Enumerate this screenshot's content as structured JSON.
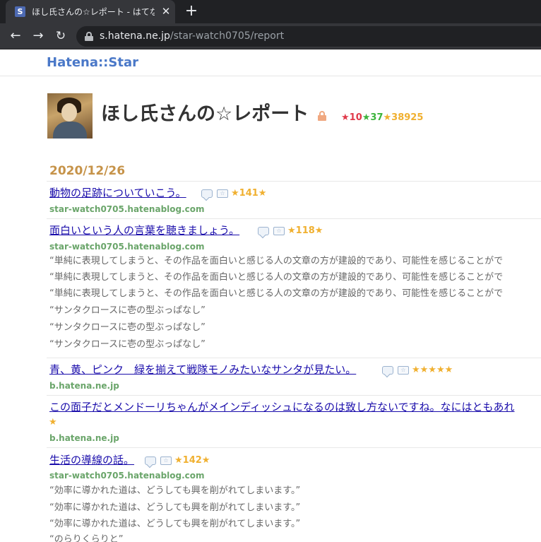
{
  "browser": {
    "tab_title": "ほし氏さんの☆レポート - はてなスター",
    "tab_favicon": "S",
    "close_glyph": "✕",
    "newtab_glyph": "+",
    "back_glyph": "←",
    "forward_glyph": "→",
    "reload_glyph": "↻",
    "url_host": "s.hatena.ne.jp",
    "url_path": "/star-watch0705/report"
  },
  "site": {
    "logo": "Hatena::Star"
  },
  "profile": {
    "title": "ほし氏さんの☆レポート",
    "stars": {
      "red_label": "★10",
      "green_label": "★37",
      "yellow_label": "★38925"
    }
  },
  "report": {
    "date": "2020/12/26",
    "entries": [
      {
        "title": "動物の足跡についていこう。",
        "star_label": "★141★",
        "domain": "star-watch0705.hatenablog.com",
        "quotes": []
      },
      {
        "title": "面白いという人の言葉を聴きましょう。",
        "star_label": "★118★",
        "domain": "star-watch0705.hatenablog.com",
        "quotes": [
          "“単純に表現してしまうと、その作品を面白いと感じる人の文章の方が建設的であり、可能性を感じることがで",
          "“単純に表現してしまうと、その作品を面白いと感じる人の文章の方が建設的であり、可能性を感じることがで",
          "“単純に表現してしまうと、その作品を面白いと感じる人の文章の方が建設的であり、可能性を感じることがで",
          "“サンタクロースに壱の型ぶっぱなし”",
          "“サンタクロースに壱の型ぶっぱなし”",
          "“サンタクロースに壱の型ぶっぱなし”"
        ]
      },
      {
        "title": "青、黄、ピンク　緑を揃えて戦隊モノみたいなサンタが見たい。",
        "star_label": "★★★★★",
        "domain": "b.hatena.ne.jp",
        "quotes": []
      },
      {
        "title": "この面子だとメンドーリちゃんがメインディッシュになるのは致し方ないですね。なにはともあれ",
        "star_label": "★",
        "domain": "b.hatena.ne.jp",
        "quotes": []
      },
      {
        "title": "生活の導線の話。",
        "star_label": "★142★",
        "domain": "star-watch0705.hatenablog.com",
        "quotes": [
          "“効率に導かれた道は、どうしても興を削がれてしまいます。”",
          "“効率に導かれた道は、どうしても興を削がれてしまいます。”",
          "“効率に導かれた道は、どうしても興を削がれてしまいます。”",
          "“のらりくらりと”"
        ]
      }
    ]
  },
  "icons": {
    "comment": "comment-icon",
    "add_star": "add-star-icon",
    "add_star_glyph": "☆"
  }
}
